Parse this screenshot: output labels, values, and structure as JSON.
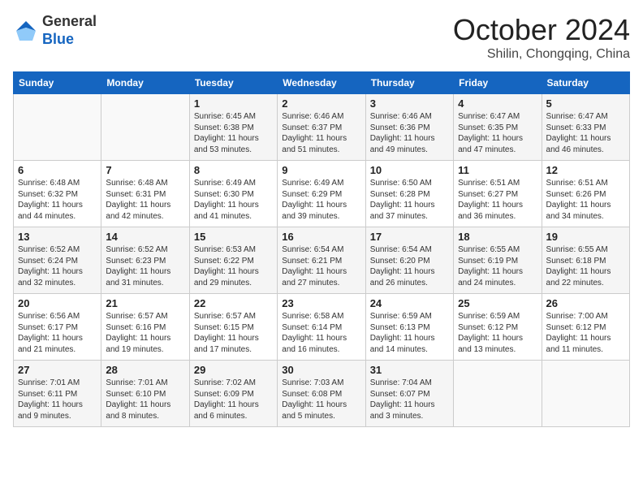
{
  "header": {
    "logo_general": "General",
    "logo_blue": "Blue",
    "month": "October 2024",
    "location": "Shilin, Chongqing, China"
  },
  "weekdays": [
    "Sunday",
    "Monday",
    "Tuesday",
    "Wednesday",
    "Thursday",
    "Friday",
    "Saturday"
  ],
  "weeks": [
    [
      {
        "day": "",
        "info": ""
      },
      {
        "day": "",
        "info": ""
      },
      {
        "day": "1",
        "info": "Sunrise: 6:45 AM\nSunset: 6:38 PM\nDaylight: 11 hours and 53 minutes."
      },
      {
        "day": "2",
        "info": "Sunrise: 6:46 AM\nSunset: 6:37 PM\nDaylight: 11 hours and 51 minutes."
      },
      {
        "day": "3",
        "info": "Sunrise: 6:46 AM\nSunset: 6:36 PM\nDaylight: 11 hours and 49 minutes."
      },
      {
        "day": "4",
        "info": "Sunrise: 6:47 AM\nSunset: 6:35 PM\nDaylight: 11 hours and 47 minutes."
      },
      {
        "day": "5",
        "info": "Sunrise: 6:47 AM\nSunset: 6:33 PM\nDaylight: 11 hours and 46 minutes."
      }
    ],
    [
      {
        "day": "6",
        "info": "Sunrise: 6:48 AM\nSunset: 6:32 PM\nDaylight: 11 hours and 44 minutes."
      },
      {
        "day": "7",
        "info": "Sunrise: 6:48 AM\nSunset: 6:31 PM\nDaylight: 11 hours and 42 minutes."
      },
      {
        "day": "8",
        "info": "Sunrise: 6:49 AM\nSunset: 6:30 PM\nDaylight: 11 hours and 41 minutes."
      },
      {
        "day": "9",
        "info": "Sunrise: 6:49 AM\nSunset: 6:29 PM\nDaylight: 11 hours and 39 minutes."
      },
      {
        "day": "10",
        "info": "Sunrise: 6:50 AM\nSunset: 6:28 PM\nDaylight: 11 hours and 37 minutes."
      },
      {
        "day": "11",
        "info": "Sunrise: 6:51 AM\nSunset: 6:27 PM\nDaylight: 11 hours and 36 minutes."
      },
      {
        "day": "12",
        "info": "Sunrise: 6:51 AM\nSunset: 6:26 PM\nDaylight: 11 hours and 34 minutes."
      }
    ],
    [
      {
        "day": "13",
        "info": "Sunrise: 6:52 AM\nSunset: 6:24 PM\nDaylight: 11 hours and 32 minutes."
      },
      {
        "day": "14",
        "info": "Sunrise: 6:52 AM\nSunset: 6:23 PM\nDaylight: 11 hours and 31 minutes."
      },
      {
        "day": "15",
        "info": "Sunrise: 6:53 AM\nSunset: 6:22 PM\nDaylight: 11 hours and 29 minutes."
      },
      {
        "day": "16",
        "info": "Sunrise: 6:54 AM\nSunset: 6:21 PM\nDaylight: 11 hours and 27 minutes."
      },
      {
        "day": "17",
        "info": "Sunrise: 6:54 AM\nSunset: 6:20 PM\nDaylight: 11 hours and 26 minutes."
      },
      {
        "day": "18",
        "info": "Sunrise: 6:55 AM\nSunset: 6:19 PM\nDaylight: 11 hours and 24 minutes."
      },
      {
        "day": "19",
        "info": "Sunrise: 6:55 AM\nSunset: 6:18 PM\nDaylight: 11 hours and 22 minutes."
      }
    ],
    [
      {
        "day": "20",
        "info": "Sunrise: 6:56 AM\nSunset: 6:17 PM\nDaylight: 11 hours and 21 minutes."
      },
      {
        "day": "21",
        "info": "Sunrise: 6:57 AM\nSunset: 6:16 PM\nDaylight: 11 hours and 19 minutes."
      },
      {
        "day": "22",
        "info": "Sunrise: 6:57 AM\nSunset: 6:15 PM\nDaylight: 11 hours and 17 minutes."
      },
      {
        "day": "23",
        "info": "Sunrise: 6:58 AM\nSunset: 6:14 PM\nDaylight: 11 hours and 16 minutes."
      },
      {
        "day": "24",
        "info": "Sunrise: 6:59 AM\nSunset: 6:13 PM\nDaylight: 11 hours and 14 minutes."
      },
      {
        "day": "25",
        "info": "Sunrise: 6:59 AM\nSunset: 6:12 PM\nDaylight: 11 hours and 13 minutes."
      },
      {
        "day": "26",
        "info": "Sunrise: 7:00 AM\nSunset: 6:12 PM\nDaylight: 11 hours and 11 minutes."
      }
    ],
    [
      {
        "day": "27",
        "info": "Sunrise: 7:01 AM\nSunset: 6:11 PM\nDaylight: 11 hours and 9 minutes."
      },
      {
        "day": "28",
        "info": "Sunrise: 7:01 AM\nSunset: 6:10 PM\nDaylight: 11 hours and 8 minutes."
      },
      {
        "day": "29",
        "info": "Sunrise: 7:02 AM\nSunset: 6:09 PM\nDaylight: 11 hours and 6 minutes."
      },
      {
        "day": "30",
        "info": "Sunrise: 7:03 AM\nSunset: 6:08 PM\nDaylight: 11 hours and 5 minutes."
      },
      {
        "day": "31",
        "info": "Sunrise: 7:04 AM\nSunset: 6:07 PM\nDaylight: 11 hours and 3 minutes."
      },
      {
        "day": "",
        "info": ""
      },
      {
        "day": "",
        "info": ""
      }
    ]
  ]
}
